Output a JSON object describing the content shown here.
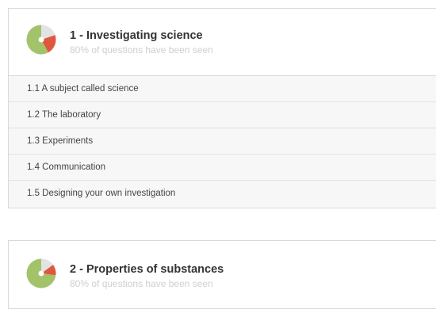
{
  "colors": {
    "seen": "#a3c36a",
    "partial": "#e0573f",
    "unseen": "#e3e3e3",
    "center": "#ffffff"
  },
  "topics": [
    {
      "title": "1 - Investigating science",
      "progress_text": "80% of questions have been seen",
      "progress": {
        "seen": 0.58,
        "partial": 0.22,
        "unseen": 0.2
      },
      "subtopics": [
        {
          "label": "1.1 A subject called science"
        },
        {
          "label": "1.2 The laboratory"
        },
        {
          "label": "1.3 Experiments"
        },
        {
          "label": "1.4 Communication"
        },
        {
          "label": "1.5 Designing your own investigation"
        }
      ]
    },
    {
      "title": "2 - Properties of substances",
      "progress_text": "80% of questions have been seen",
      "progress": {
        "seen": 0.73,
        "partial": 0.12,
        "unseen": 0.15
      },
      "subtopics": []
    }
  ]
}
